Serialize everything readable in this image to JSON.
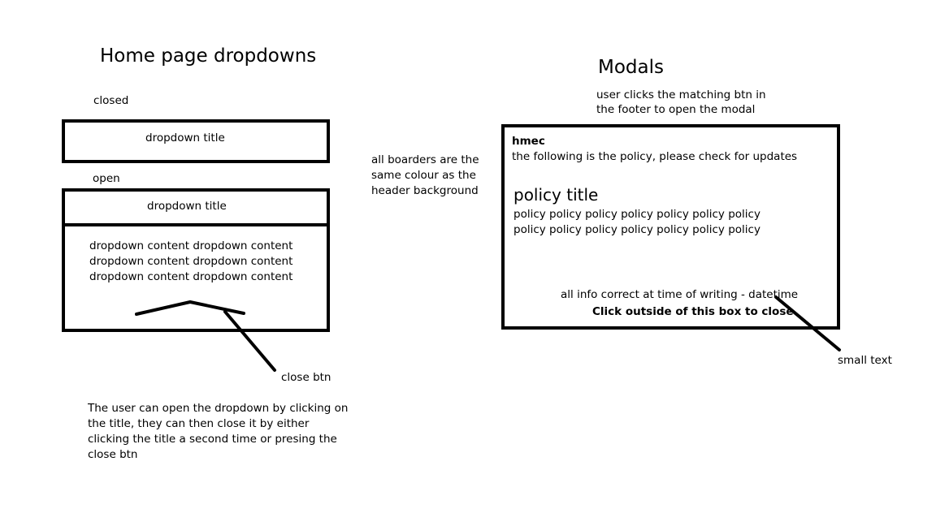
{
  "left": {
    "heading": "Home page dropdowns",
    "closed_label": "closed",
    "open_label": "open",
    "dropdown_title_closed": "dropdown title",
    "dropdown_title_open": "dropdown title",
    "content_lines": [
      "dropdown content dropdown content",
      "dropdown content dropdown content",
      "dropdown content dropdown content"
    ],
    "close_btn_label": "close btn",
    "description_lines": [
      "The user can open the dropdown by clicking on",
      "the title, they can then close it by either",
      "clicking the title a second time or presing the",
      "close btn"
    ]
  },
  "middle": {
    "note_lines": [
      "all boarders are the",
      "same colour as the",
      "header background"
    ]
  },
  "right": {
    "heading": "Modals",
    "intro_lines": [
      "user clicks the matching btn in",
      "the footer to open the modal"
    ],
    "modal": {
      "brand": "hmec",
      "subtitle": "the following is the policy, please check for updates",
      "policy_title": "policy title",
      "policy_lines": [
        "policy  policy  policy  policy  policy  policy policy",
        "policy  policy  policy  policy  policy  policy policy"
      ],
      "footer_note": "all info correct at time of writing - datetime",
      "close_hint": "Click outside of this box to close"
    },
    "small_text_label": "small text"
  }
}
